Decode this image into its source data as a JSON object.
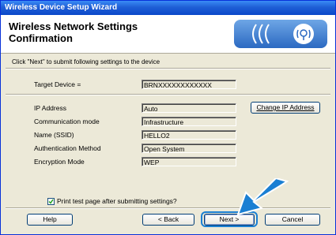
{
  "window": {
    "title": "Wireless Device Setup Wizard"
  },
  "header": {
    "title": "Wireless Network Settings Confirmation"
  },
  "instruction": "Click \"Next\" to submit following settings to the device",
  "target_device": {
    "label": "Target Device =",
    "value": "BRNXXXXXXXXXXXX"
  },
  "settings": [
    {
      "label": "IP Address",
      "value": "Auto"
    },
    {
      "label": "Communication mode",
      "value": "Infrastructure"
    },
    {
      "label": "Name (SSID)",
      "value": "HELLO2"
    },
    {
      "label": "Authentication Method",
      "value": "Open System"
    },
    {
      "label": "Encryption Mode",
      "value": "WEP"
    }
  ],
  "change_ip_button": "Change IP Address",
  "print_checkbox": {
    "label": "Print test page after submitting settings?",
    "checked": true
  },
  "buttons": {
    "help": "Help",
    "back": "< Back",
    "next": "Next >",
    "cancel": "Cancel"
  },
  "colors": {
    "title_bar": "#1f5fd6",
    "dialog_bg": "#ece9d8",
    "arrow": "#1a7fd3"
  },
  "icons": {
    "logo": "wireless-signal-icon",
    "arrow": "pointer-arrow-icon",
    "check": "check-icon"
  }
}
